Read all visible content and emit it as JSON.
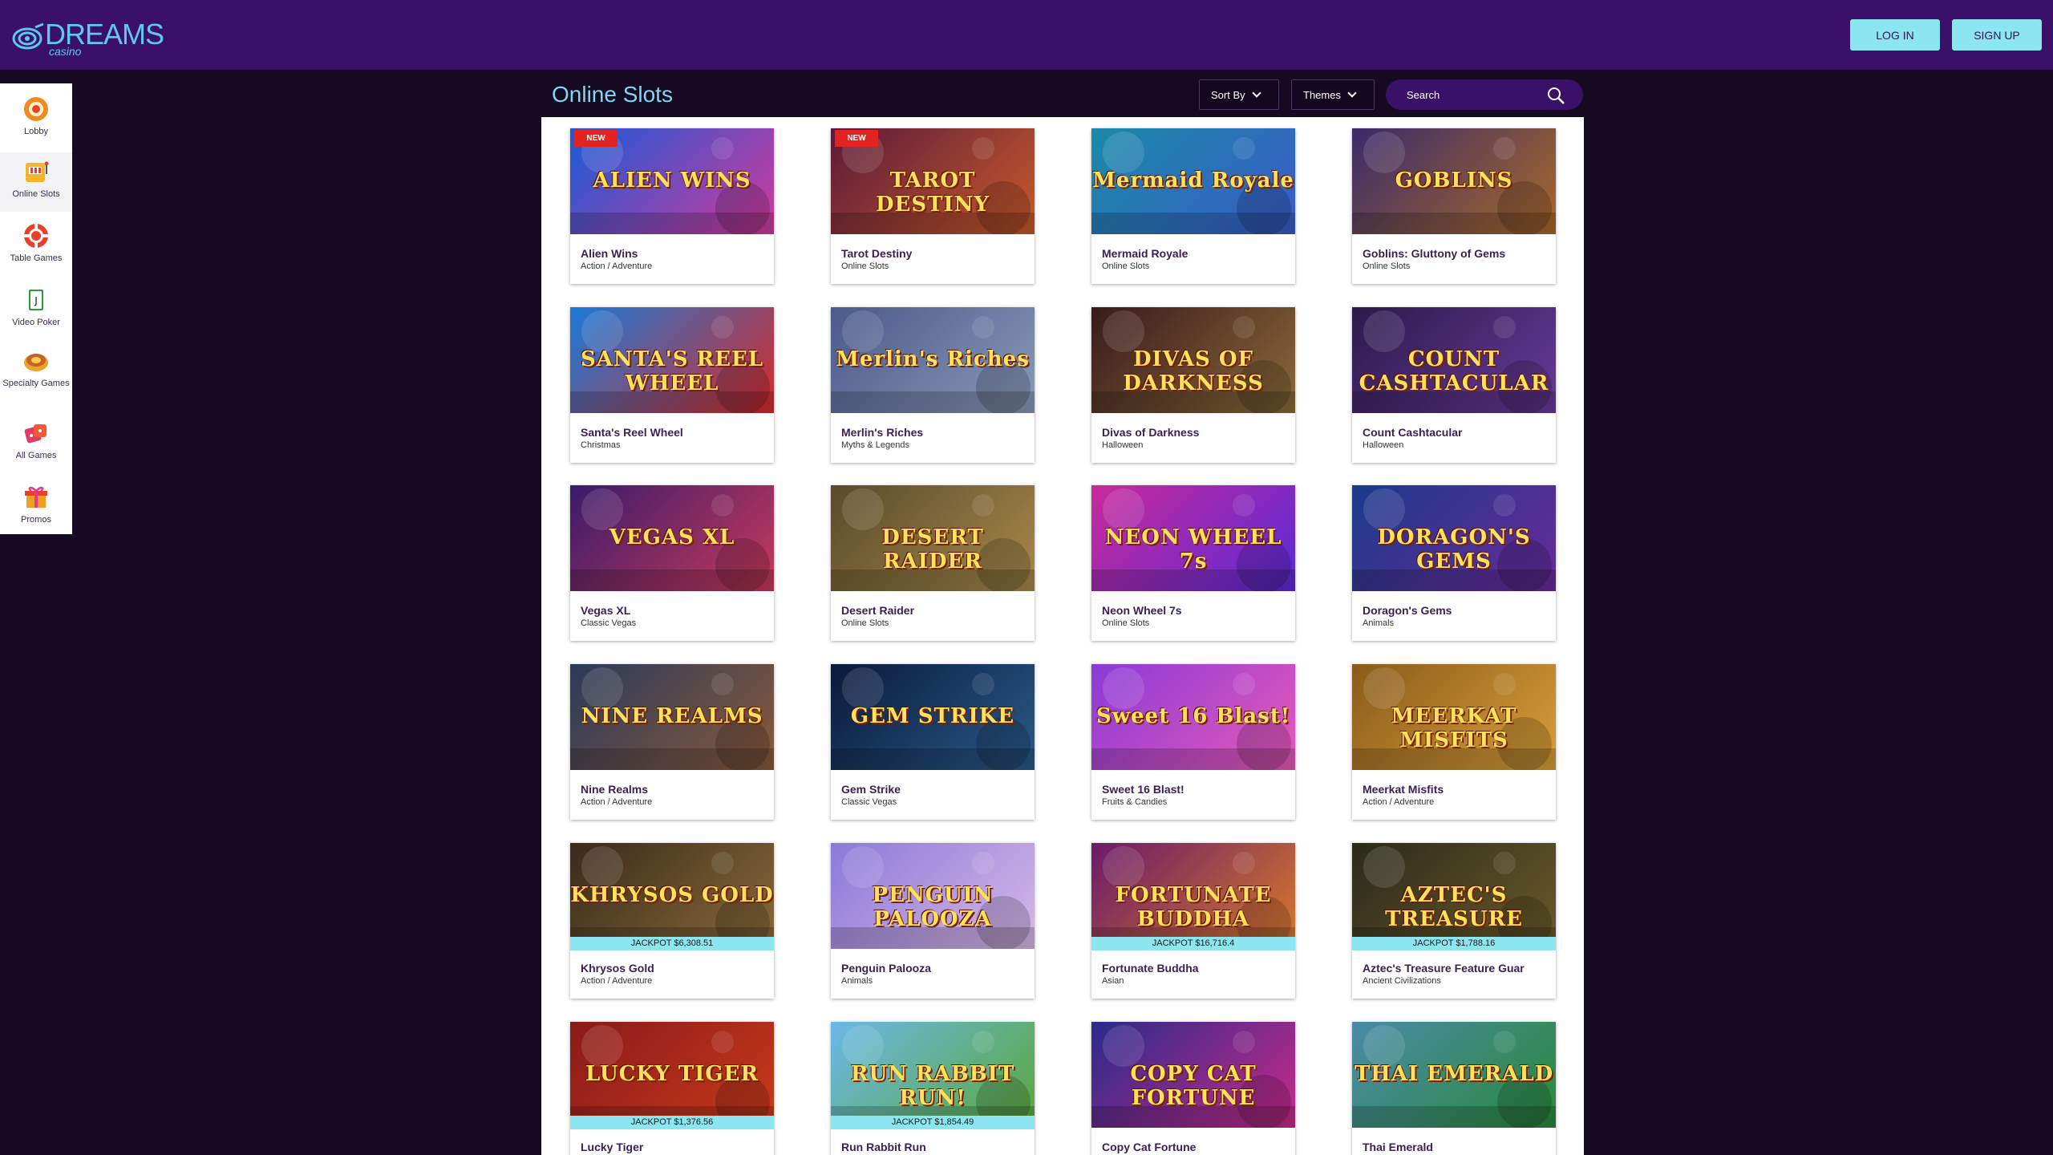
{
  "header": {
    "logo_text": "DREAMS",
    "logo_sub": "casino",
    "login_label": "LOG IN",
    "signup_label": "SIGN UP",
    "accent_color": "#3a1068",
    "button_color": "#8ce6f0"
  },
  "sidebar": {
    "items": [
      {
        "label": "Lobby",
        "icon": "lobby-icon",
        "color": "#f08a24"
      },
      {
        "label": "Online Slots",
        "icon": "slot-machine-icon",
        "color": "#f5b52a"
      },
      {
        "label": "Table Games",
        "icon": "poker-chip-icon",
        "color": "#e8402a"
      },
      {
        "label": "Video Poker",
        "icon": "playing-card-icon",
        "color": "#2c9a3c"
      },
      {
        "label": "Specialty Games",
        "icon": "wheel-icon",
        "color": "#e8a52a"
      },
      {
        "label": "All Games",
        "icon": "dice-icon",
        "color": "#e33a6a"
      },
      {
        "label": "Promos",
        "icon": "gift-icon",
        "color": "#f0a020"
      }
    ]
  },
  "main": {
    "title": "Online Slots",
    "sort_label": "Sort By",
    "themes_label": "Themes",
    "search_placeholder": "Search"
  },
  "games": [
    {
      "name": "Alien Wins",
      "category": "Action / Adventure",
      "badge": "NEW",
      "jackpot": "",
      "art": "ALIEN WINS",
      "bg1": "#1a5ad8",
      "bg2": "#d23a9a"
    },
    {
      "name": "Tarot Destiny",
      "category": "Online Slots",
      "badge": "NEW",
      "jackpot": "",
      "art": "TAROT DESTINY",
      "bg1": "#5a1a3a",
      "bg2": "#c85a2a"
    },
    {
      "name": "Mermaid Royale",
      "category": "Online Slots",
      "badge": "",
      "jackpot": "",
      "art": "Mermaid Royale",
      "bg1": "#1a8aa8",
      "bg2": "#3a5ac8"
    },
    {
      "name": "Goblins: Gluttony of Gems",
      "category": "Online Slots",
      "badge": "",
      "jackpot": "",
      "art": "GOBLINS",
      "bg1": "#3a2a6a",
      "bg2": "#a86a2a"
    },
    {
      "name": "Santa's Reel Wheel",
      "category": "Christmas",
      "badge": "",
      "jackpot": "",
      "art": "SANTA'S REEL WHEEL",
      "bg1": "#1a7ad8",
      "bg2": "#d82a2a"
    },
    {
      "name": "Merlin's Riches",
      "category": "Myths & Legends",
      "badge": "",
      "jackpot": "",
      "art": "Merlin's Riches",
      "bg1": "#4a5a8a",
      "bg2": "#8a9ab8"
    },
    {
      "name": "Divas of Darkness",
      "category": "Halloween",
      "badge": "",
      "jackpot": "",
      "art": "DIVAS OF DARKNESS",
      "bg1": "#3a1a1a",
      "bg2": "#8a6a3a"
    },
    {
      "name": "Count Cashtacular",
      "category": "Halloween",
      "badge": "",
      "jackpot": "",
      "art": "COUNT CASHTACULAR",
      "bg1": "#2a1a4a",
      "bg2": "#6a3a9a"
    },
    {
      "name": "Vegas XL",
      "category": "Classic Vegas",
      "badge": "",
      "jackpot": "",
      "art": "VEGAS XL",
      "bg1": "#3a1a6a",
      "bg2": "#c83a5a"
    },
    {
      "name": "Desert Raider",
      "category": "Online Slots",
      "badge": "",
      "jackpot": "",
      "art": "DESERT RAIDER",
      "bg1": "#5a4a2a",
      "bg2": "#a88a4a"
    },
    {
      "name": "Neon Wheel 7s",
      "category": "Online Slots",
      "badge": "",
      "jackpot": "",
      "art": "NEON WHEEL 7s",
      "bg1": "#c82a9a",
      "bg2": "#5a2ad8"
    },
    {
      "name": "Doragon's Gems",
      "category": "Animals",
      "badge": "",
      "jackpot": "",
      "art": "DORAGON'S GEMS",
      "bg1": "#1a3a8a",
      "bg2": "#6a2a9a"
    },
    {
      "name": "Nine Realms",
      "category": "Action / Adventure",
      "badge": "",
      "jackpot": "",
      "art": "NINE REALMS",
      "bg1": "#2a3a5a",
      "bg2": "#8a5a3a"
    },
    {
      "name": "Gem Strike",
      "category": "Classic Vegas",
      "badge": "",
      "jackpot": "",
      "art": "GEM STRIKE",
      "bg1": "#0a1a3a",
      "bg2": "#2a5a8a"
    },
    {
      "name": "Sweet 16 Blast!",
      "category": "Fruits & Candies",
      "badge": "",
      "jackpot": "",
      "art": "Sweet 16 Blast!",
      "bg1": "#8a3ad8",
      "bg2": "#e85ab8"
    },
    {
      "name": "Meerkat Misfits",
      "category": "Action / Adventure",
      "badge": "",
      "jackpot": "",
      "art": "MEERKAT MISFITS",
      "bg1": "#8a5a1a",
      "bg2": "#d8a03a"
    },
    {
      "name": "Khrysos Gold",
      "category": "Action / Adventure",
      "badge": "",
      "jackpot": "JACKPOT $6,308.51",
      "art": "KHRYSOS GOLD",
      "bg1": "#3a2a1a",
      "bg2": "#8a6a3a"
    },
    {
      "name": "Penguin Palooza",
      "category": "Animals",
      "badge": "",
      "jackpot": "",
      "art": "PENGUIN PALOOZA",
      "bg1": "#8a7ad8",
      "bg2": "#d8b8e8"
    },
    {
      "name": "Fortunate Buddha",
      "category": "Asian",
      "badge": "",
      "jackpot": "JACKPOT $16,716.4",
      "art": "FORTUNATE BUDDHA",
      "bg1": "#6a1a6a",
      "bg2": "#d87a2a"
    },
    {
      "name": "Aztec's Treasure Feature Guar",
      "category": "Ancient Civilizations",
      "badge": "",
      "jackpot": "JACKPOT $1,788.16",
      "art": "AZTEC'S TREASURE",
      "bg1": "#2a2a1a",
      "bg2": "#6a5a2a"
    },
    {
      "name": "Lucky Tiger",
      "category": "",
      "badge": "",
      "jackpot": "JACKPOT $1,376.56",
      "art": "LUCKY TIGER",
      "bg1": "#8a1a1a",
      "bg2": "#c83a1a"
    },
    {
      "name": "Run Rabbit Run",
      "category": "",
      "badge": "",
      "jackpot": "JACKPOT $1,854.49",
      "art": "RUN RABBIT RUN!",
      "bg1": "#6ab8e8",
      "bg2": "#5aa83a"
    },
    {
      "name": "Copy Cat Fortune",
      "category": "",
      "badge": "",
      "jackpot": "",
      "art": "COPY CAT FORTUNE",
      "bg1": "#2a2a8a",
      "bg2": "#c82a8a"
    },
    {
      "name": "Thai Emerald",
      "category": "",
      "badge": "",
      "jackpot": "",
      "art": "THAI EMERALD",
      "bg1": "#4a8aa8",
      "bg2": "#2a8a3a"
    }
  ]
}
